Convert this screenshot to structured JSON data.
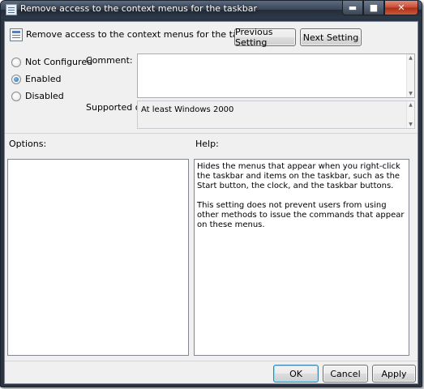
{
  "window": {
    "title": "Remove access to the context menus for the taskbar",
    "minimize": "▬",
    "maximize": "■",
    "close": "✕"
  },
  "header": {
    "title": "Remove access to the context menus for the taskbar",
    "icon": "policy-setting-icon"
  },
  "nav": {
    "previous": "Previous Setting",
    "next": "Next Setting"
  },
  "state": {
    "options": [
      {
        "label": "Not Configured",
        "checked": false
      },
      {
        "label": "Enabled",
        "checked": true
      },
      {
        "label": "Disabled",
        "checked": false
      }
    ]
  },
  "comment": {
    "label": "Comment:",
    "value": ""
  },
  "supported": {
    "label": "Supported on:",
    "value": "At least Windows 2000"
  },
  "options_panel": {
    "label": "Options:"
  },
  "help_panel": {
    "label": "Help:",
    "paragraphs": [
      "Hides the menus that appear when you right-click the taskbar and items on the taskbar, such as the Start button, the clock, and the taskbar buttons.",
      "This setting does not prevent users from using other methods to issue the commands that appear on these menus."
    ]
  },
  "footer": {
    "ok": "OK",
    "cancel": "Cancel",
    "apply": "Apply"
  },
  "colors": {
    "accent": "#3c7fb1",
    "window_bg": "#f0f0f0",
    "titlebar": "#2e3948",
    "close": "#c74a33"
  }
}
